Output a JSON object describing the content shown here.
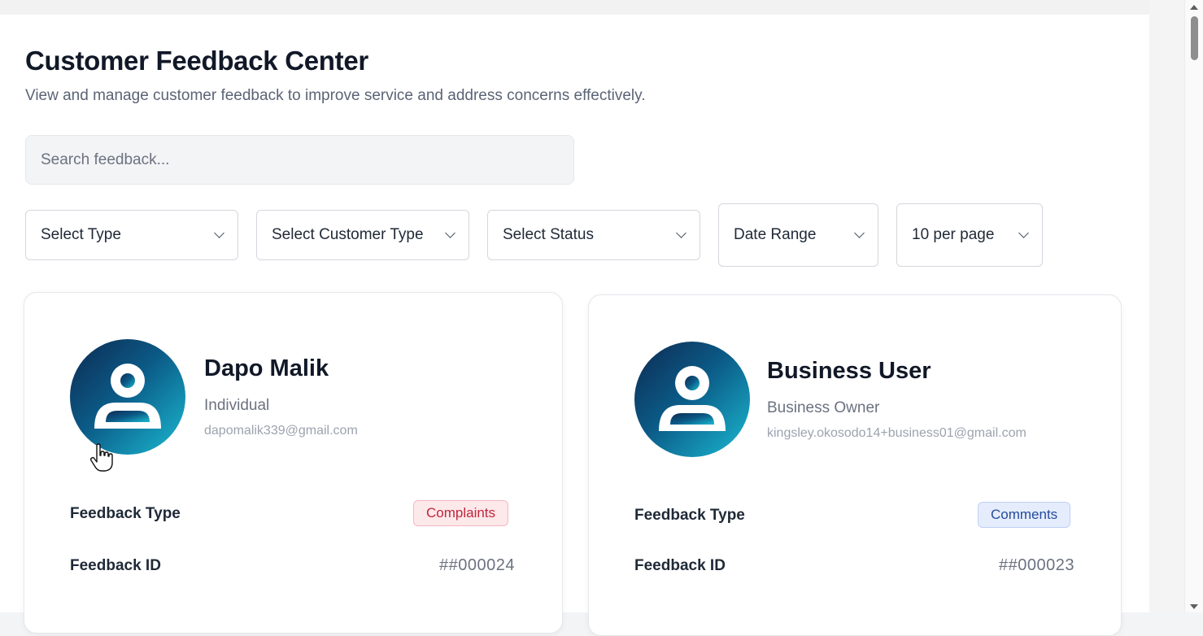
{
  "header": {
    "title": "Customer Feedback Center",
    "subtitle": "View and manage customer feedback to improve service and address concerns effectively."
  },
  "search": {
    "placeholder": "Search feedback..."
  },
  "filters": {
    "type": "Select Type",
    "customer_type": "Select Customer Type",
    "status": "Select Status",
    "date_range": "Date Range",
    "per_page": "10 per page"
  },
  "cards": [
    {
      "name": "Dapo Malik",
      "customer_type": "Individual",
      "email": "dapomalik339@gmail.com",
      "feedback_type_label": "Feedback Type",
      "feedback_type": "Complaints",
      "feedback_id_label": "Feedback ID",
      "feedback_id": "##000024"
    },
    {
      "name": "Business User",
      "customer_type": "Business Owner",
      "email": "kingsley.okosodo14+business01@gmail.com",
      "feedback_type_label": "Feedback Type",
      "feedback_type": "Comments",
      "feedback_id_label": "Feedback ID",
      "feedback_id": "##000023"
    }
  ],
  "colors": {
    "complaints_badge": "#c0263a",
    "comments_badge": "#254a9b",
    "avatar_dark": "#0d2a52",
    "avatar_light": "#1bbad2"
  },
  "icons": {
    "avatar": "user-silhouette-icon",
    "dropdown": "chevron-down-icon",
    "cursor": "hand-pointer-icon"
  }
}
